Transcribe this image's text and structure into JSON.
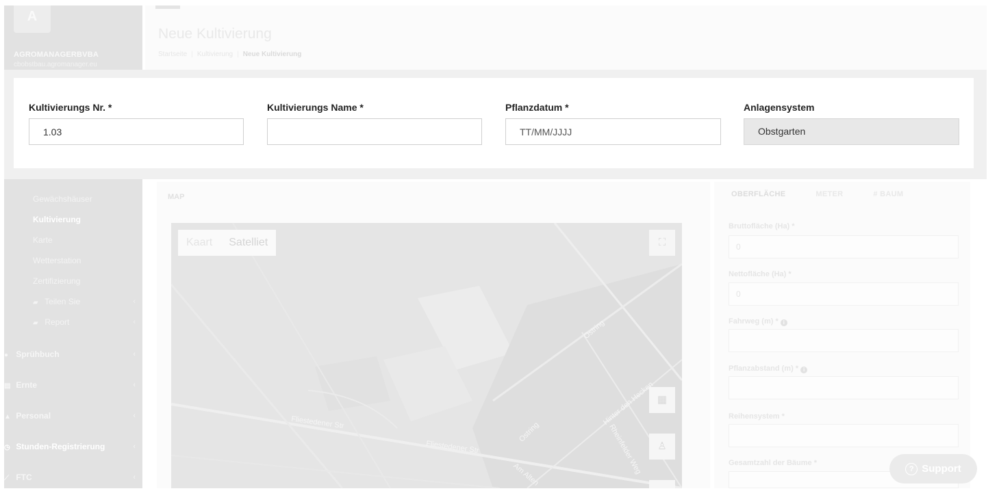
{
  "sidebar": {
    "logo_letter": "A",
    "company_name": "AGROMANAGERBVBA",
    "company_sub": "cbobstbau.agromanager.eu",
    "items": [
      {
        "label": "Gewächshäuser",
        "icon": "",
        "chevron": ""
      },
      {
        "label": "Kultivierung",
        "icon": "",
        "chevron": ""
      },
      {
        "label": "Karte",
        "icon": "",
        "chevron": ""
      },
      {
        "label": "Wetterstation",
        "icon": "",
        "chevron": ""
      },
      {
        "label": "Zertifizierung",
        "icon": "",
        "chevron": ""
      },
      {
        "label": "Teilen Sie",
        "icon": "folder-icon",
        "chevron": "‹"
      },
      {
        "label": "Report",
        "icon": "folder-icon",
        "chevron": "‹"
      }
    ],
    "top_items": [
      {
        "label": "Sprühbuch",
        "icon": "drop-icon",
        "chevron": "‹"
      },
      {
        "label": "Ernte",
        "icon": "basket-icon",
        "chevron": "‹"
      },
      {
        "label": "Personal",
        "icon": "user-icon",
        "chevron": "‹"
      },
      {
        "label": "Stunden-Registrierung",
        "icon": "clock-icon",
        "chevron": "‹"
      },
      {
        "label": "FTC",
        "icon": "chart-line-icon",
        "chevron": "‹"
      }
    ]
  },
  "header": {
    "title": "Neue Kultivierung",
    "breadcrumb": [
      "Startseite",
      "Kultivierung",
      "Neue Kultivierung"
    ]
  },
  "form": {
    "nr_label": "Kultivierungs Nr. *",
    "nr_value": "1.03",
    "name_label": "Kultivierungs Name *",
    "name_value": "",
    "date_label": "Pflanzdatum *",
    "date_placeholder": "TT/MM/JJJJ",
    "system_label": "Anlagensystem",
    "system_value": "Obstgarten"
  },
  "map": {
    "section_label": "MAP",
    "type_options": [
      "Kaart",
      "Satelliet"
    ],
    "selected_type": "Satelliet",
    "roads": [
      "Fliestedener Str",
      "Fliestedener Str",
      "Ostring",
      "Ostring",
      "Hinter den Hecken",
      "Rheinfelder Weg",
      "Am Alten"
    ]
  },
  "right": {
    "tabs": [
      "OBERFLÄCHE",
      "METER",
      "# BAUM"
    ],
    "fields": [
      {
        "label": "Bruttofläche (Ha) *",
        "value": "0",
        "info": false
      },
      {
        "label": "Nettofläche (Ha) *",
        "value": "0",
        "info": false
      },
      {
        "label": "Fahrweg (m) *",
        "value": "",
        "info": true
      },
      {
        "label": "Pflanzabstand (m) *",
        "value": "",
        "info": true
      },
      {
        "label": "Reihensystem *",
        "value": "",
        "info": false
      },
      {
        "label": "Gesamtzahl der Bäume *",
        "value": "",
        "info": false
      }
    ]
  },
  "support": {
    "label": "Support",
    "icon": "question-circle-icon"
  }
}
